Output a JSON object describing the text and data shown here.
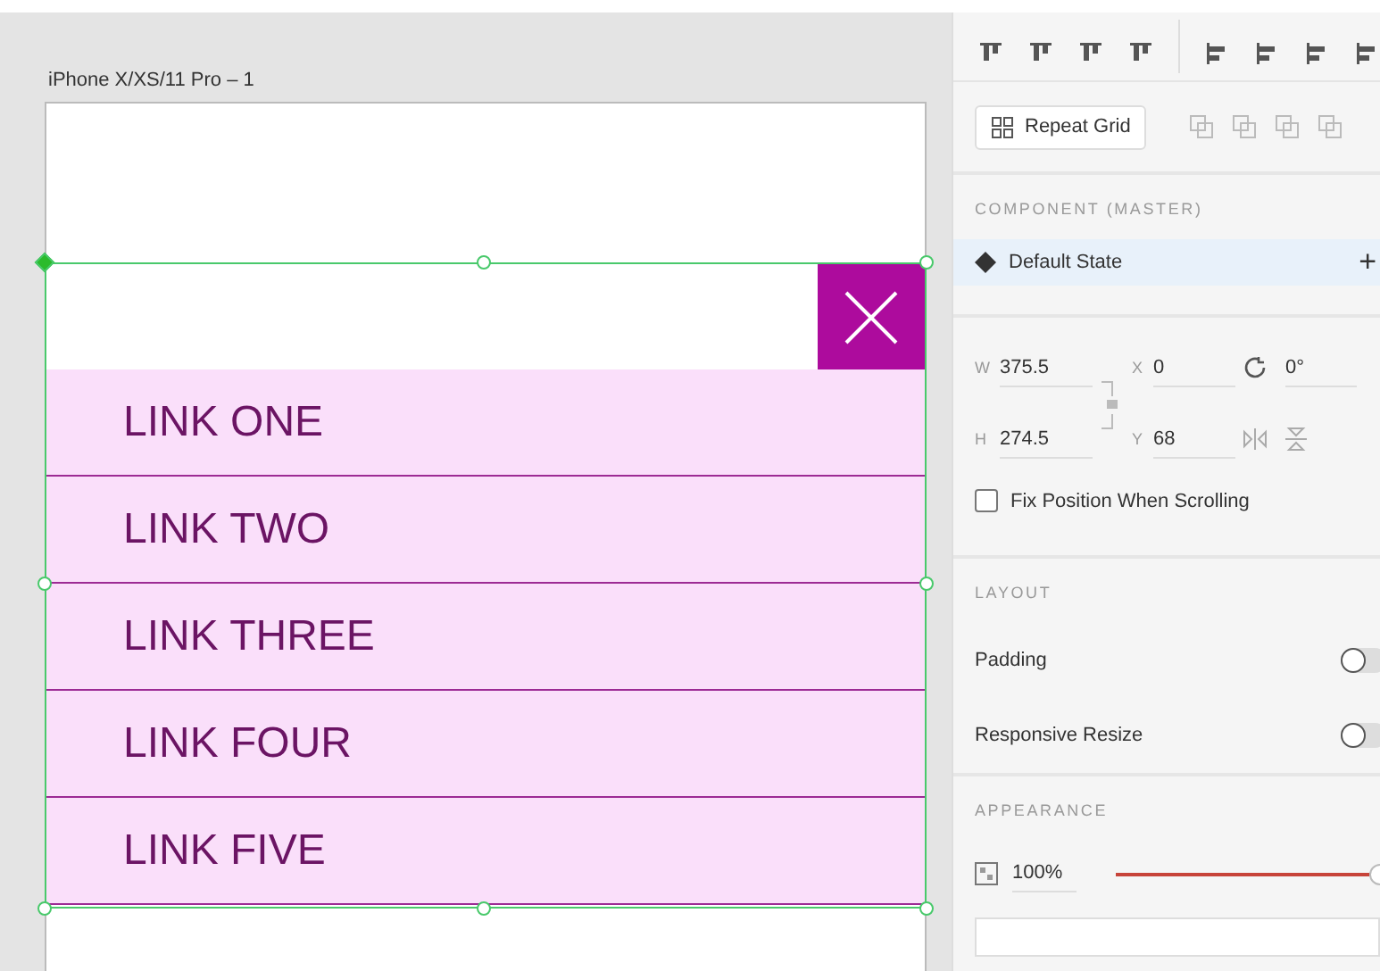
{
  "artboard": {
    "title": "iPhone X/XS/11 Pro – 1",
    "menu": {
      "links": [
        {
          "label": "LINK ONE"
        },
        {
          "label": "LINK TWO"
        },
        {
          "label": "LINK THREE"
        },
        {
          "label": "LINK FOUR"
        },
        {
          "label": "LINK FIVE"
        }
      ]
    }
  },
  "inspector": {
    "repeat_grid": "Repeat Grid",
    "component": {
      "heading": "COMPONENT (MASTER)",
      "state": "Default State",
      "add": "+"
    },
    "transform": {
      "w": {
        "label": "W",
        "value": "375.5"
      },
      "x": {
        "label": "X",
        "value": "0"
      },
      "rotation": "0°",
      "h": {
        "label": "H",
        "value": "274.5"
      },
      "y": {
        "label": "Y",
        "value": "68"
      }
    },
    "fix_position": {
      "label": "Fix Position When Scrolling",
      "checked": false
    },
    "layout": {
      "heading": "LAYOUT",
      "options": [
        {
          "label": "Padding",
          "on": false
        },
        {
          "label": "Responsive Resize",
          "on": false
        }
      ]
    },
    "appearance": {
      "heading": "APPEARANCE",
      "opacity": {
        "value": "100%",
        "level": 1
      }
    }
  }
}
